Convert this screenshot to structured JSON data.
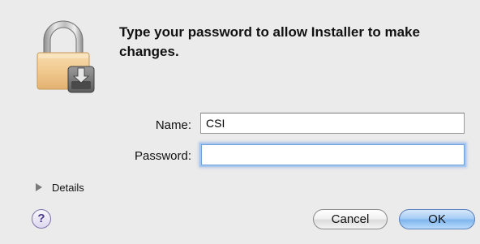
{
  "dialog": {
    "message": "Type your password to allow Installer to make changes.",
    "lock_icon": "lock-installer-icon"
  },
  "form": {
    "name_label": "Name:",
    "name_value": "CSI",
    "password_label": "Password:",
    "password_value": ""
  },
  "details": {
    "label": "Details",
    "expanded": false
  },
  "buttons": {
    "help_label": "?",
    "cancel_label": "Cancel",
    "ok_label": "OK"
  },
  "colors": {
    "background": "#ebebeb",
    "focus_ring": "#a9c6ee",
    "default_button": "#7fb5ee"
  }
}
